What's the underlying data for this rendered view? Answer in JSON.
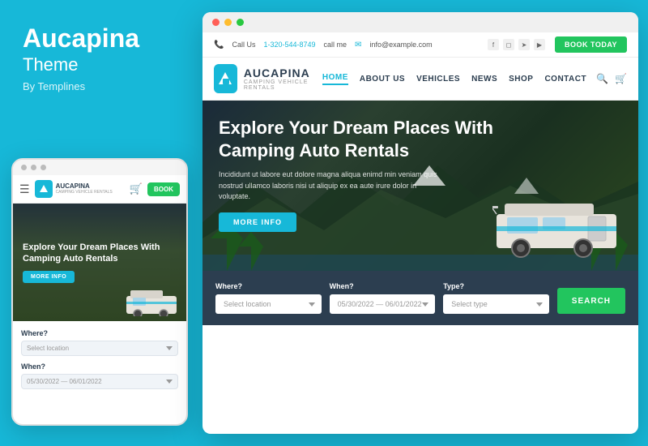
{
  "left": {
    "title": "Aucapina",
    "subtitle": "Theme",
    "by": "By Templines"
  },
  "mobile": {
    "dots": [
      "dot1",
      "dot2",
      "dot3"
    ],
    "nav": {
      "logo_text": "AUCAPINA",
      "logo_sub": "CAMPING VEHICLE RENTALS",
      "book_label": "BOOK"
    },
    "hero": {
      "title": "Explore Your Dream Places With Camping Auto Rentals",
      "more_info": "MORE INFO"
    },
    "form": {
      "where_label": "Where?",
      "where_placeholder": "Select location",
      "when_label": "When?",
      "when_placeholder": "05/30/2022 — 06/01/2022"
    }
  },
  "desktop": {
    "browser_dots": [
      "red",
      "yellow",
      "green"
    ],
    "topbar": {
      "phone": "1-320-544-8749",
      "call_me": "call me",
      "email": "info@example.com",
      "book_label": "BOOK TODAY"
    },
    "nav": {
      "logo_text": "AUCAPINA",
      "logo_sub": "CAMPING VEHICLE RENTALS",
      "links": [
        {
          "label": "HOME",
          "active": true
        },
        {
          "label": "ABOUT US",
          "active": false
        },
        {
          "label": "VEHICLES",
          "active": false
        },
        {
          "label": "NEWS",
          "active": false
        },
        {
          "label": "SHOP",
          "active": false
        },
        {
          "label": "CONTACT",
          "active": false
        }
      ]
    },
    "hero": {
      "title": "Explore Your Dream Places With\nCamping Auto Rentals",
      "subtitle": "Incididunt ut labore eut dolore magna aliqua enimd min veniam quis nostrud ullamco laboris nisi ut aliquip ex ea aute irure dolor in voluptate.",
      "more_info": "MORE INFO"
    },
    "search": {
      "where_label": "Where?",
      "where_placeholder": "Select location",
      "when_label": "When?",
      "when_value": "05/30/2022 — 06/01/2022",
      "type_label": "Type?",
      "type_placeholder": "Select type",
      "search_label": "SEARCH"
    }
  }
}
